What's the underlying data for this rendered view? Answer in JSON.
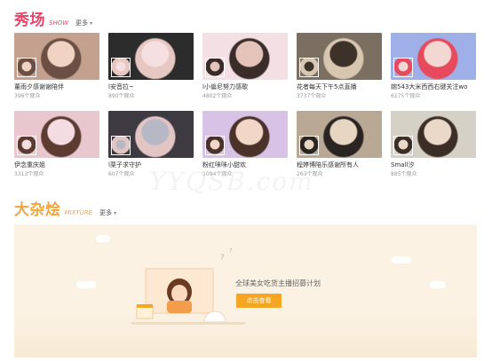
{
  "show_section": {
    "title": "秀场",
    "subtitle": "SHOW",
    "more": "更多"
  },
  "show_cards": [
    {
      "title": "董雨夕感谢谢陪伴",
      "views": "396个观众",
      "colors": [
        "#c4a08e",
        "#6b4f44",
        "#f0d3c2"
      ]
    },
    {
      "title": "l安音拉~",
      "views": "890个观众",
      "colors": [
        "#2c2c2c",
        "#e7c7c2",
        "#f5dfe0"
      ]
    },
    {
      "title": "l小倫尼努力感歌",
      "views": "4802个观众",
      "colors": [
        "#f3dfe4",
        "#3a2c28",
        "#e4c4b8"
      ]
    },
    {
      "title": "花者每天下午5点直播",
      "views": "3737个观众",
      "colors": [
        "#7a6f60",
        "#d8c6b0",
        "#3c3229"
      ]
    },
    {
      "title": "婉543大米西西右键关注wo",
      "views": "6175个观众",
      "colors": [
        "#9fb0e8",
        "#e64a5c",
        "#f2d7d2"
      ]
    },
    {
      "title": "伊念重庆姐",
      "views": "3313个观众",
      "colors": [
        "#e8c7cf",
        "#5e3b30",
        "#f4dde2"
      ]
    },
    {
      "title": "l栗子求守护",
      "views": "607个观众",
      "colors": [
        "#3d3a42",
        "#e3c6c3",
        "#b7b8c6"
      ]
    },
    {
      "title": "粉红咪咪小甜欢",
      "views": "1094个观众",
      "colors": [
        "#d8c3e6",
        "#4a322a",
        "#f2d7c8"
      ]
    },
    {
      "title": "程婷博陪乐感谢所有人",
      "views": "263个观众",
      "colors": [
        "#b9a894",
        "#2a2522",
        "#e6d6c2"
      ]
    },
    {
      "title": "Small汐",
      "views": "885个观众",
      "colors": [
        "#d6d1c7",
        "#3b2e26",
        "#ead8c8"
      ]
    }
  ],
  "mix_section": {
    "title": "大杂烩",
    "subtitle": "MIXTURE",
    "more": "更多"
  },
  "mix_banner": {
    "text": "全球美女吃货主播招募计划",
    "button": "点击查看",
    "accent": "#f5a623"
  },
  "watermark": "YYQSB.com"
}
